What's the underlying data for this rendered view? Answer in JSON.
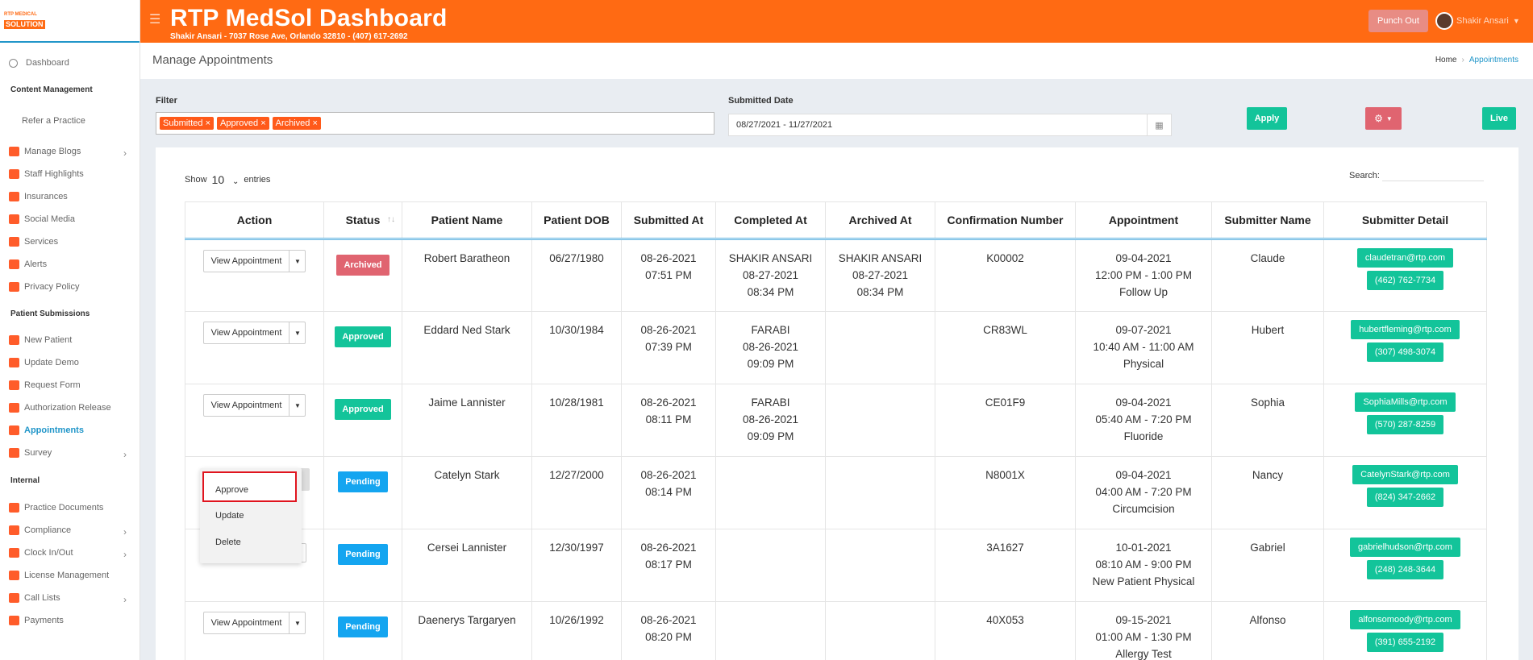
{
  "sidebar": {
    "logo_line1": "RTP MEDICAL",
    "logo_line2": "SOLUTION",
    "dashboard": "Dashboard",
    "content_management": "Content Management",
    "refer_practice": "Refer a Practice",
    "content_items": [
      "Manage Blogs",
      "Staff Highlights",
      "Insurances",
      "Social Media",
      "Services",
      "Alerts",
      "Privacy Policy"
    ],
    "patient_submissions": "Patient Submissions",
    "patient_items": [
      "New Patient",
      "Update Demo",
      "Request Form",
      "Authorization Release",
      "Appointments",
      "Survey"
    ],
    "internal": "Internal",
    "internal_items": [
      "Practice Documents",
      "Compliance",
      "Clock In/Out",
      "License Management",
      "Call Lists",
      "Payments"
    ]
  },
  "header": {
    "title": "RTP MedSol Dashboard",
    "subtitle": "Shakir Ansari - 7037 Rose Ave, Orlando 32810 - (407) 617-2692",
    "punch_out": "Punch Out",
    "user_name": "Shakir Ansari"
  },
  "page": {
    "title": "Manage Appointments",
    "breadcrumb_home": "Home",
    "breadcrumb_current": "Appointments"
  },
  "filter": {
    "label": "Filter",
    "tags": [
      "Submitted",
      "Approved",
      "Archived"
    ],
    "date_label": "Submitted Date",
    "date_range": "08/27/2021 - 11/27/2021",
    "apply": "Apply",
    "live": "Live"
  },
  "table": {
    "show": "Show",
    "entries_count": "10",
    "entries": "entries",
    "search": "Search:",
    "headers": [
      "Action",
      "Status",
      "Patient Name",
      "Patient DOB",
      "Submitted At",
      "Completed At",
      "Archived At",
      "Confirmation Number",
      "Appointment",
      "Submitter Name",
      "Submitter Detail"
    ],
    "view_label": "View Appointment",
    "rows": [
      {
        "status": "Archived",
        "name": "Robert Baratheon",
        "dob": "06/27/1980",
        "sub_date": "08-26-2021",
        "sub_time": "07:51 PM",
        "comp_by": "SHAKIR ANSARI",
        "comp_date": "08-27-2021",
        "comp_time": "08:34 PM",
        "arch_by": "SHAKIR ANSARI",
        "arch_date": "08-27-2021",
        "arch_time": "08:34 PM",
        "conf": "K00002",
        "appt_date": "09-04-2021",
        "appt_time": "12:00 PM - 1:00 PM",
        "appt_type": "Follow Up",
        "submitter": "Claude",
        "email": "claudetran@rtp.com",
        "phone": "(462) 762-7734"
      },
      {
        "status": "Approved",
        "name": "Eddard Ned Stark",
        "dob": "10/30/1984",
        "sub_date": "08-26-2021",
        "sub_time": "07:39 PM",
        "comp_by": "FARABI",
        "comp_date": "08-26-2021",
        "comp_time": "09:09 PM",
        "arch_by": "",
        "arch_date": "",
        "arch_time": "",
        "conf": "CR83WL",
        "appt_date": "09-07-2021",
        "appt_time": "10:40 AM - 11:00 AM",
        "appt_type": "Physical",
        "submitter": "Hubert",
        "email": "hubertfleming@rtp.com",
        "phone": "(307) 498-3074"
      },
      {
        "status": "Approved",
        "name": "Jaime Lannister",
        "dob": "10/28/1981",
        "sub_date": "08-26-2021",
        "sub_time": "08:11 PM",
        "comp_by": "FARABI",
        "comp_date": "08-26-2021",
        "comp_time": "09:09 PM",
        "arch_by": "",
        "arch_date": "",
        "arch_time": "",
        "conf": "CE01F9",
        "appt_date": "09-04-2021",
        "appt_time": "05:40 AM - 7:20 PM",
        "appt_type": "Fluoride",
        "submitter": "Sophia",
        "email": "SophiaMills@rtp.com",
        "phone": "(570) 287-8259"
      },
      {
        "status": "Pending",
        "name": "Catelyn Stark",
        "dob": "12/27/2000",
        "sub_date": "08-26-2021",
        "sub_time": "08:14 PM",
        "comp_by": "",
        "comp_date": "",
        "comp_time": "",
        "arch_by": "",
        "arch_date": "",
        "arch_time": "",
        "conf": "N8001X",
        "appt_date": "09-04-2021",
        "appt_time": "04:00 AM - 7:20 PM",
        "appt_type": "Circumcision",
        "submitter": "Nancy",
        "email": "CatelynStark@rtp.com",
        "phone": "(824) 347-2662"
      },
      {
        "status": "Pending",
        "name": "Cersei Lannister",
        "dob": "12/30/1997",
        "sub_date": "08-26-2021",
        "sub_time": "08:17 PM",
        "comp_by": "",
        "comp_date": "",
        "comp_time": "",
        "arch_by": "",
        "arch_date": "",
        "arch_time": "",
        "conf": "3A1627",
        "appt_date": "10-01-2021",
        "appt_time": "08:10 AM - 9:00 PM",
        "appt_type": "New Patient Physical",
        "submitter": "Gabriel",
        "email": "gabrielhudson@rtp.com",
        "phone": "(248) 248-3644"
      },
      {
        "status": "Pending",
        "name": "Daenerys Targaryen",
        "dob": "10/26/1992",
        "sub_date": "08-26-2021",
        "sub_time": "08:20 PM",
        "comp_by": "",
        "comp_date": "",
        "comp_time": "",
        "arch_by": "",
        "arch_date": "",
        "arch_time": "",
        "conf": "40X053",
        "appt_date": "09-15-2021",
        "appt_time": "01:00 AM - 1:30 PM",
        "appt_type": "Allergy Test",
        "submitter": "Alfonso",
        "email": "alfonsomoody@rtp.com",
        "phone": "(391) 655-2192"
      }
    ]
  },
  "dropdown": {
    "approve": "Approve",
    "update": "Update",
    "delete": "Delete"
  },
  "colors": {
    "brand_orange": "#ff6a13",
    "accent_blue": "#2196c9",
    "green": "#13c49a",
    "red": "#e06470",
    "pending_blue": "#14a5f0"
  }
}
